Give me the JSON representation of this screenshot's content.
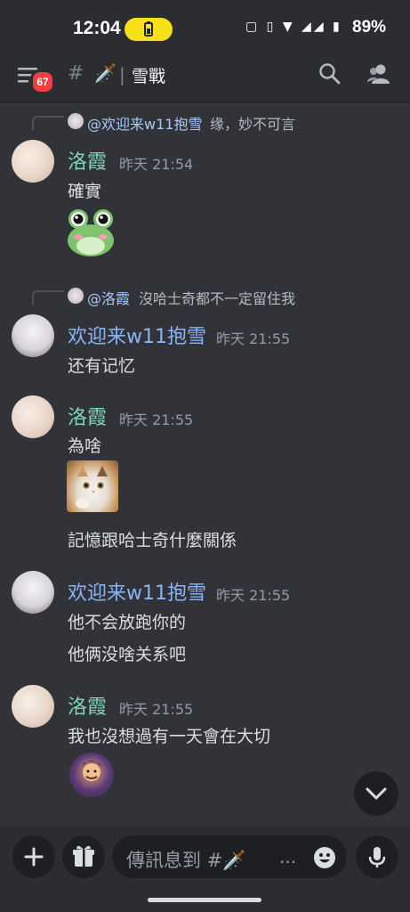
{
  "status_bar": {
    "time": "12:04",
    "battery": "89%"
  },
  "header": {
    "badge_count": "67",
    "channel_emoji": "🗡️",
    "channel_separator": "|",
    "channel_name": "雪戰"
  },
  "messages": [
    {
      "reply_to": {
        "name": "@欢迎来w11抱雪",
        "text": "缘，妙不可言"
      },
      "author": "洛霞",
      "timestamp": "昨天 21:54",
      "lines": [
        "確實"
      ],
      "has_frog_sticker": true
    },
    {
      "reply_to": {
        "name": "@洛霞",
        "text": "沒哈士奇都不一定留住我"
      },
      "author": "欢迎来w11抱雪",
      "timestamp": "昨天 21:55",
      "lines": [
        "还有记忆"
      ]
    },
    {
      "author": "洛霞",
      "timestamp": "昨天 21:55",
      "lines": [
        "為啥",
        "記憶跟哈士奇什麼關係"
      ],
      "has_cat_image": true
    },
    {
      "author": "欢迎来w11抱雪",
      "timestamp": "昨天 21:55",
      "lines": [
        "他不会放跑你的",
        "他俩没啥关系吧"
      ]
    },
    {
      "author": "洛霞",
      "timestamp": "昨天 21:55",
      "lines": [
        "我也沒想過有一天會在大切"
      ],
      "has_sticker": true
    }
  ],
  "composer": {
    "placeholder": "傳訊息到 #🗡️",
    "ellipsis": "..."
  },
  "colors": {
    "background": "#313338",
    "header": "#2b2d31",
    "name_luo": "#7fd6b6",
    "name_huan": "#8ab4f8",
    "badge": "#f23f43"
  }
}
